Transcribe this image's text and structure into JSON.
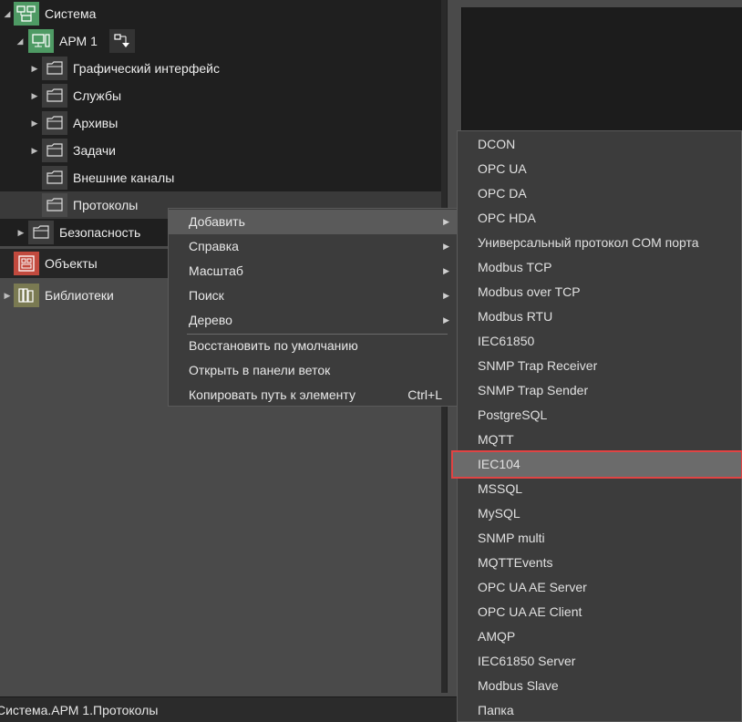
{
  "tree": {
    "items": [
      {
        "label": "Система",
        "icon": "system-icon"
      },
      {
        "label": "АРМ 1",
        "icon": "workstation-icon",
        "extra_icon": "route-icon"
      },
      {
        "label": "Графический интерфейс",
        "icon": "folder-icon"
      },
      {
        "label": "Службы",
        "icon": "folder-icon"
      },
      {
        "label": "Архивы",
        "icon": "folder-icon"
      },
      {
        "label": "Задачи",
        "icon": "folder-icon"
      },
      {
        "label": "Внешние каналы",
        "icon": "folder-icon"
      },
      {
        "label": "Протоколы",
        "icon": "folder-icon"
      },
      {
        "label": "Безопасность",
        "icon": "folder-icon"
      }
    ],
    "objects_label": "Объекты",
    "libraries_label": "Библиотеки"
  },
  "context_menu": {
    "items": [
      {
        "label": "Добавить"
      },
      {
        "label": "Справка"
      },
      {
        "label": "Масштаб"
      },
      {
        "label": "Поиск"
      },
      {
        "label": "Дерево"
      },
      {
        "label": "Восстановить по умолчанию"
      },
      {
        "label": "Открыть в панели веток"
      },
      {
        "label": "Копировать путь к элементу",
        "shortcut": "Ctrl+L"
      }
    ]
  },
  "submenu": {
    "items": [
      "DCON",
      "OPC UA",
      "OPC DA",
      "OPC HDA",
      "Универсальный протокол COM порта",
      "Modbus TCP",
      "Modbus over TCP",
      "Modbus RTU",
      "IEC61850",
      "SNMP Trap Receiver",
      "SNMP Trap Sender",
      "PostgreSQL",
      "MQTT",
      "IEC104",
      "MSSQL",
      "MySQL",
      "SNMP multi",
      "MQTTEvents",
      "OPC UA AE Server",
      "OPC UA AE Client",
      "AMQP",
      "IEC61850 Server",
      "Modbus Slave",
      "Папка"
    ],
    "highlighted": "IEC104"
  },
  "status_bar": {
    "path": "Система.АРМ 1.Протоколы"
  },
  "colors": {
    "accent_highlight": "#e04444",
    "system_icon_bg": "#4e9a64",
    "objects_icon_bg": "#c24a3e",
    "libraries_icon_bg": "#7a7a52"
  }
}
